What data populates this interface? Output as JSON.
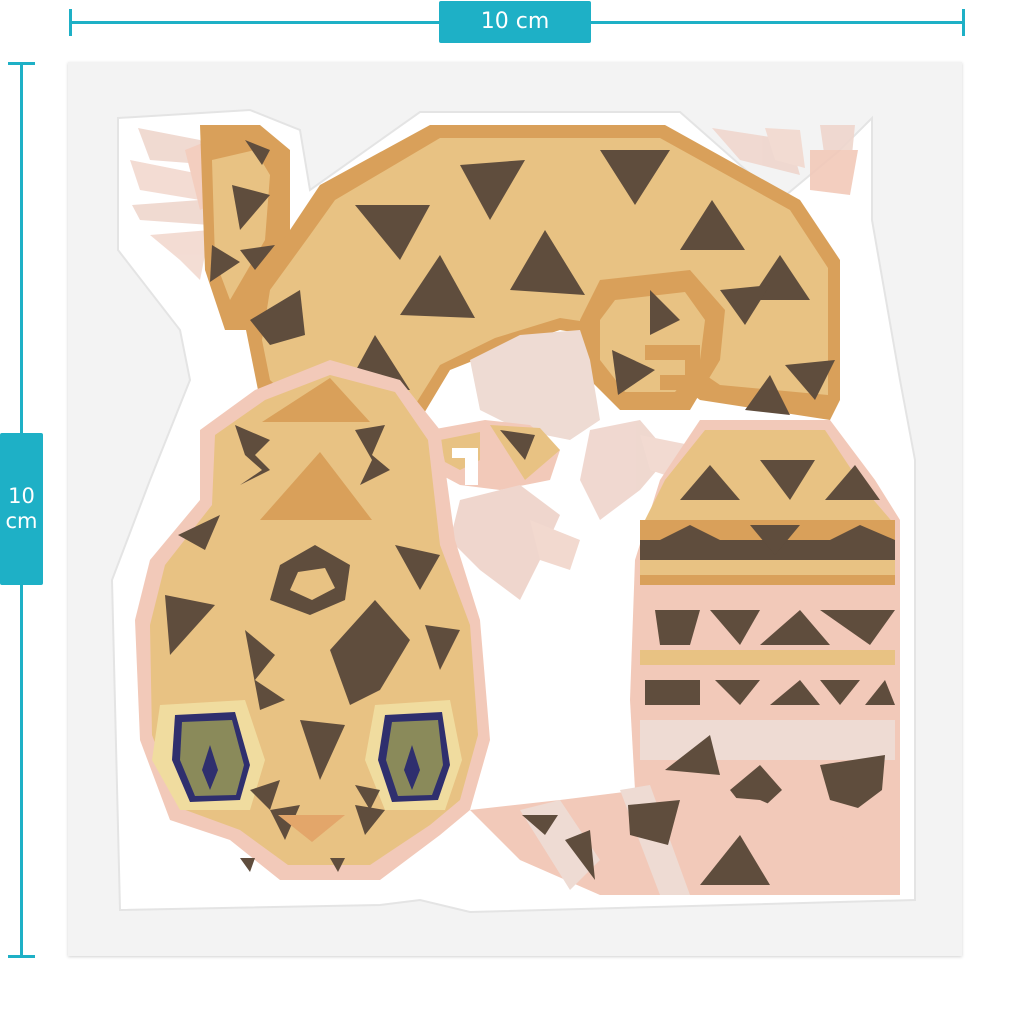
{
  "dimensions": {
    "width_label": "10 cm",
    "height_label": [
      "10",
      "cm"
    ]
  },
  "colors": {
    "accent": "#1eb0c6",
    "sheet": "#f3f3f3",
    "body": "#e8c283",
    "body_shade": "#d9a05a",
    "spot": "#5f4d3d",
    "belly_pink": "#f2c9b9",
    "light_pink": "#eedbd3",
    "eye_iris": "#8a8a5a",
    "eye_ring": "#2f2f6e",
    "eye_outer": "#f0dc9f"
  },
  "icons": {
    "artwork": "leopard-gecko-sticker-icon"
  }
}
